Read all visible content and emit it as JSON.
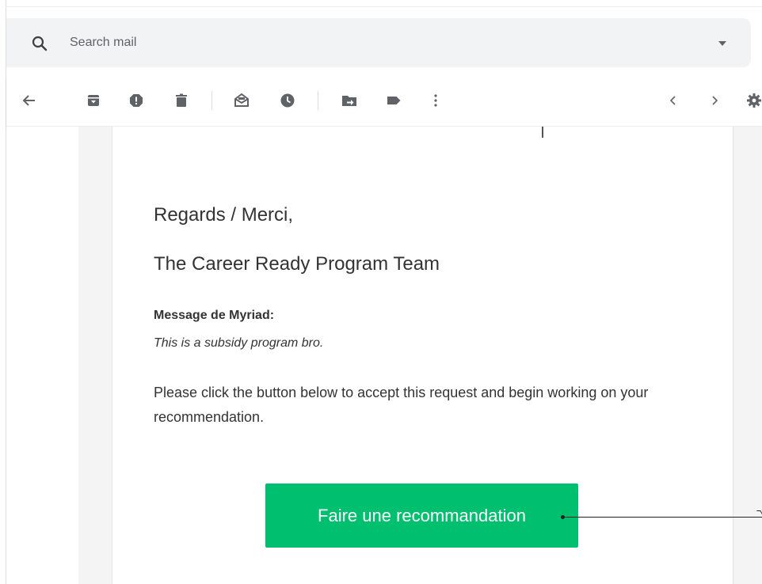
{
  "search": {
    "placeholder": "Search mail",
    "icon": "search-icon",
    "dropdown_icon": "caret-down-icon"
  },
  "toolbar": {
    "buttons": [
      "back-arrow-icon",
      "archive-icon",
      "report-spam-icon",
      "delete-icon",
      "mark-unread-icon",
      "snooze-icon",
      "move-to-icon",
      "label-icon",
      "more-options-icon",
      "previous-chevron-icon",
      "next-chevron-icon",
      "settings-gear-icon"
    ]
  },
  "email": {
    "regards": "Regards / Merci,",
    "team": "The Career Ready Program Team",
    "message_label": "Message de Myriad:",
    "message_text": "This is a subsidy program bro.",
    "instruction": "Please click the button below to accept this request and begin working on your recommendation.",
    "cta_label": "Faire une recommandation"
  },
  "colors": {
    "cta": "#00bf6f",
    "search_bg": "#f1f3f4",
    "toolbar_icon": "#5f6368",
    "text": "#333333"
  }
}
